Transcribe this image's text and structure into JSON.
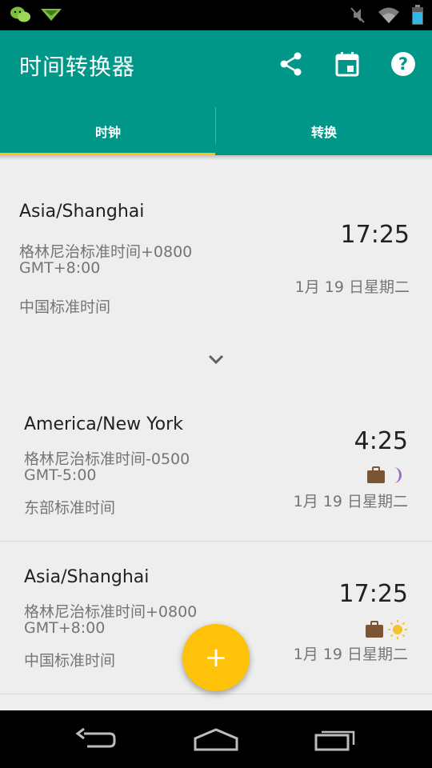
{
  "app": {
    "title": "时间转换器"
  },
  "tabs": [
    {
      "label": "时钟",
      "active": true
    },
    {
      "label": "转换",
      "active": false
    }
  ],
  "colors": {
    "primary": "#009788",
    "accent": "#ffc20a"
  },
  "main_clock": {
    "zone": "Asia/Shanghai",
    "offset_text": "格林尼治标准时间+0800",
    "gmt": "GMT+8:00",
    "name": "中国标准时间",
    "time": "17:25",
    "date": "1月 19 日星期二"
  },
  "clocks": [
    {
      "zone": "America/New York",
      "offset_text": "格林尼治标准时间-0500",
      "gmt": "GMT-5:00",
      "name": "东部标准时间",
      "time": "4:25",
      "date": "1月 19 日星期二",
      "icons": [
        "briefcase-icon",
        "moon-icon"
      ]
    },
    {
      "zone": "Asia/Shanghai",
      "offset_text": "格林尼治标准时间+0800",
      "gmt": "GMT+8:00",
      "name": "中国标准时间",
      "time": "17:25",
      "date": "1月 19 日星期二",
      "icons": [
        "briefcase-icon",
        "sun-icon"
      ]
    }
  ],
  "fab": {
    "label": "+"
  }
}
